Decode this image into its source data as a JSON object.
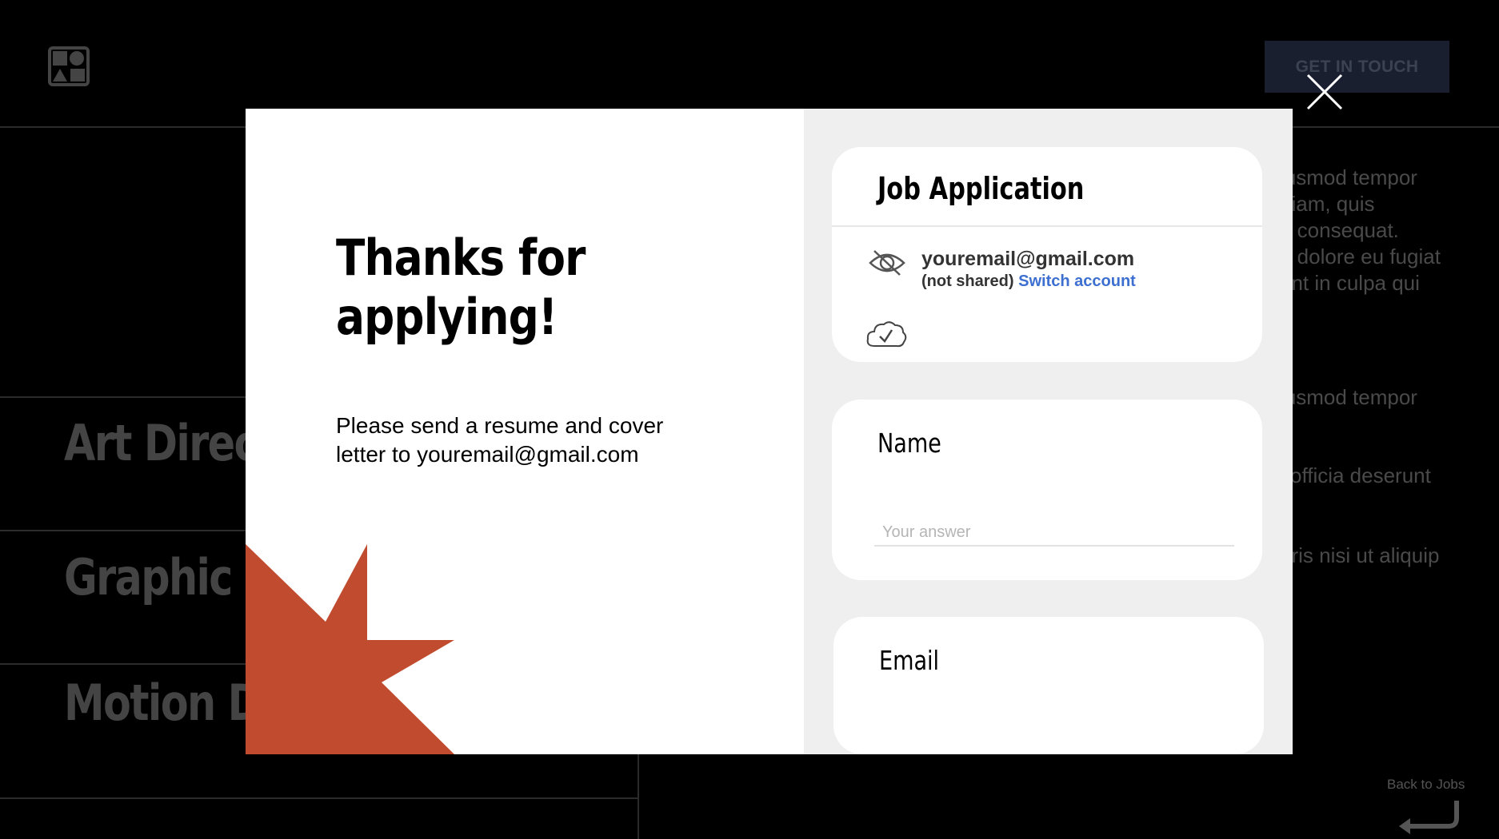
{
  "background": {
    "cta_label": "GET IN TOUCH",
    "jobs": [
      "Art Direc",
      "Graphic",
      "Motion D"
    ],
    "text_fragments": [
      "iusmod tempor",
      "niam, quis",
      "o consequat.",
      "n dolore eu fugiat",
      "unt in culpa qui",
      "iusmod tempor",
      "i officia deserunt",
      "oris nisi ut aliquip"
    ],
    "back_label": "Back to Jobs"
  },
  "modal": {
    "title_line1": "Thanks for",
    "title_line2": "applying!",
    "body": "Please send a resume and cover letter to youremail@gmail.com",
    "accent_color": "#c14b2f"
  },
  "form": {
    "title": "Job Application",
    "account_email": "youremail@gmail.com",
    "not_shared": "(not shared)",
    "switch_account": "Switch account",
    "questions": [
      {
        "label": "Name",
        "placeholder": "Your answer"
      },
      {
        "label": "Email"
      }
    ]
  },
  "icons": {
    "close": "close-icon",
    "hidden": "eye-slash-icon",
    "cloud": "cloud-check-icon",
    "logo": "grid-logo-icon",
    "back": "return-arrow-icon"
  }
}
